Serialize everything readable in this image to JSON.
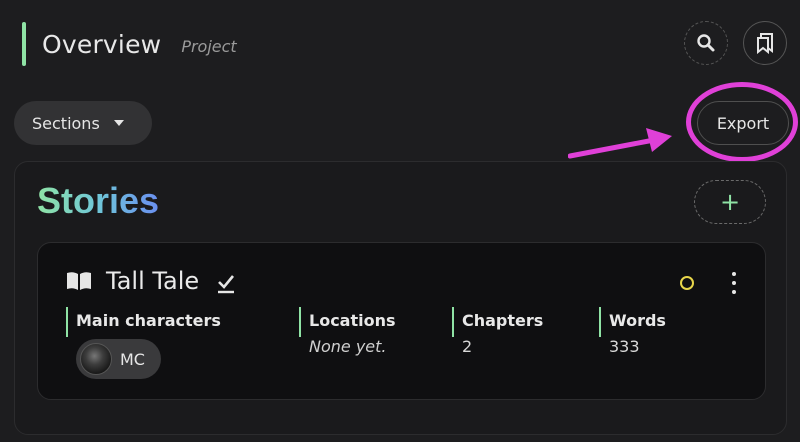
{
  "header": {
    "title": "Overview",
    "subtitle": "Project"
  },
  "toolbar": {
    "search_icon": "search-icon",
    "bookmarks_icon": "bookmarks-icon",
    "sections_label": "Sections",
    "export_label": "Export"
  },
  "stories": {
    "title": "Stories",
    "add_label": "+",
    "items": [
      {
        "name": "Tall Tale",
        "status_color": "#e7d54a",
        "main_characters_label": "Main characters",
        "characters": [
          {
            "label": "MC"
          }
        ],
        "locations_label": "Locations",
        "locations_value": "None yet.",
        "chapters_label": "Chapters",
        "chapters_value": "2",
        "words_label": "Words",
        "words_value": "333"
      }
    ]
  },
  "colors": {
    "accent": "#8fe3a5",
    "highlight": "#e040d8",
    "status": "#e7d54a"
  }
}
